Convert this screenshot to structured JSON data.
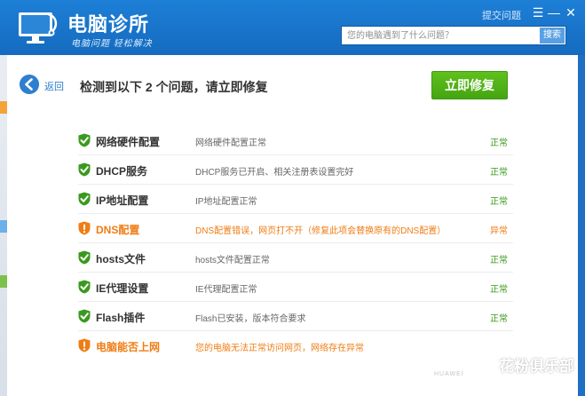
{
  "app": {
    "title": "电脑诊所",
    "slogan": "电脑问题 轻松解决",
    "feedback_link": "提交问题",
    "min_button": "☰",
    "minimize_button": "—",
    "close_button": "✕"
  },
  "search": {
    "placeholder": "您的电脑遇到了什么问题？",
    "button_label": "搜索"
  },
  "toolbar": {
    "back_label": "返回",
    "headline": "检测到以下 2 个问题，请立即修复",
    "fix_button_label": "立即修复"
  },
  "colors": {
    "ok": "#3a9a1d",
    "warn": "#ef7d14",
    "accent": "#1d7fd6",
    "fix_button": "#52b418"
  },
  "rows": [
    {
      "name": "网络硬件配置",
      "desc": "网络硬件配置正常",
      "status": "正常",
      "level": "ok",
      "icon": "shield-check-icon"
    },
    {
      "name": "DHCP服务",
      "desc": "DHCP服务已开启、相关注册表设置完好",
      "status": "正常",
      "level": "ok",
      "icon": "shield-check-icon"
    },
    {
      "name": "IP地址配置",
      "desc": "IP地址配置正常",
      "status": "正常",
      "level": "ok",
      "icon": "shield-check-icon"
    },
    {
      "name": "DNS配置",
      "desc": "DNS配置错误，网页打不开（修复此项会替换原有的DNS配置）",
      "status": "异常",
      "level": "warn",
      "icon": "shield-warning-icon"
    },
    {
      "name": "hosts文件",
      "desc": "hosts文件配置正常",
      "status": "正常",
      "level": "ok",
      "icon": "shield-check-icon"
    },
    {
      "name": "IE代理设置",
      "desc": "IE代理配置正常",
      "status": "正常",
      "level": "ok",
      "icon": "shield-check-icon"
    },
    {
      "name": "Flash插件",
      "desc": "Flash已安装，版本符合要求",
      "status": "正常",
      "level": "ok",
      "icon": "shield-check-icon"
    },
    {
      "name": "电脑能否上网",
      "desc": "您的电脑无法正常访问网页，网络存在异常",
      "status": "",
      "level": "warn",
      "icon": "shield-warning-icon"
    }
  ],
  "watermark": {
    "text": "花粉俱乐部",
    "brand": "HUAWEI"
  }
}
